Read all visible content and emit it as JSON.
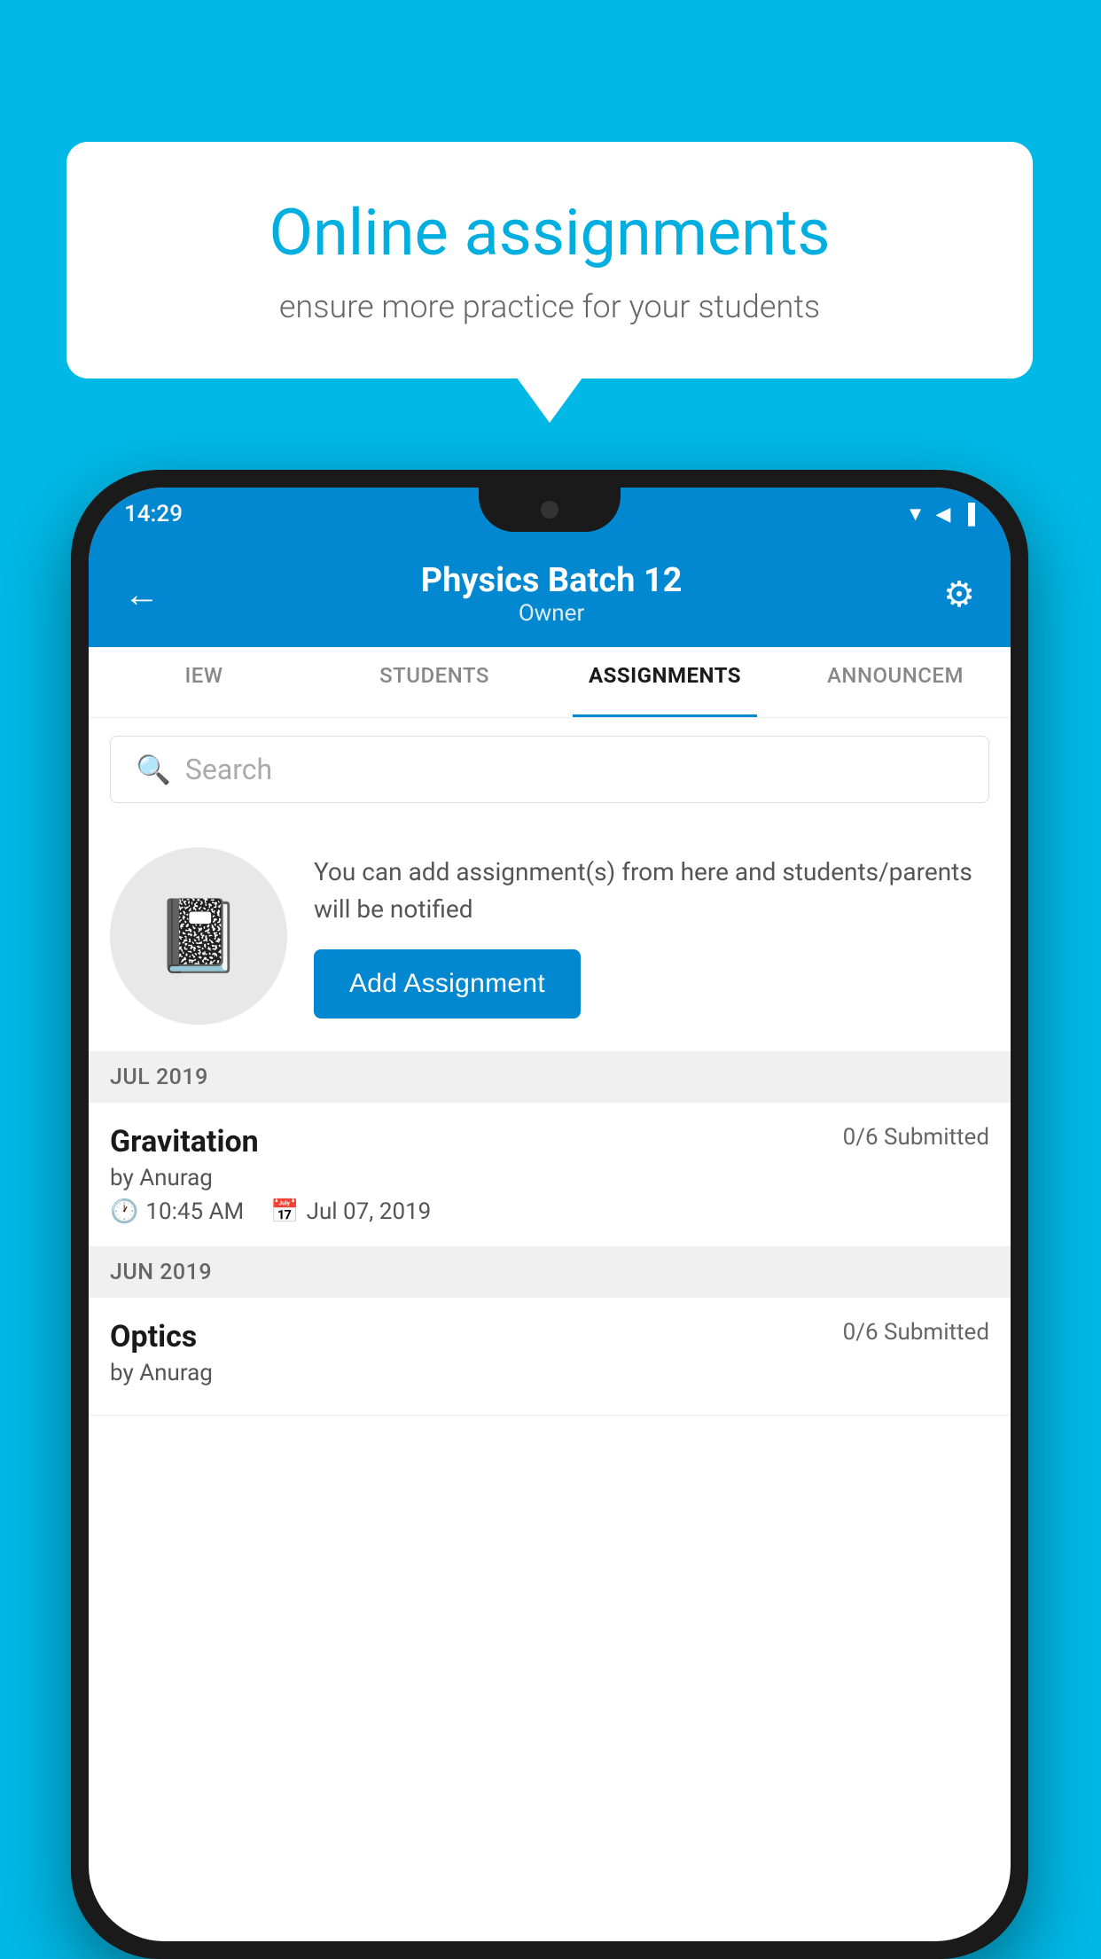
{
  "background": {
    "color": "#00b8e6"
  },
  "speech_bubble": {
    "title": "Online assignments",
    "subtitle": "ensure more practice for your students"
  },
  "status_bar": {
    "time": "14:29",
    "wifi_icon": "wifi",
    "signal_icon": "signal",
    "battery_icon": "battery"
  },
  "app_header": {
    "back_icon": "←",
    "title": "Physics Batch 12",
    "subtitle": "Owner",
    "settings_icon": "⚙"
  },
  "tabs": [
    {
      "label": "IEW",
      "active": false
    },
    {
      "label": "STUDENTS",
      "active": false
    },
    {
      "label": "ASSIGNMENTS",
      "active": true
    },
    {
      "label": "ANNOUNCEM",
      "active": false
    }
  ],
  "search": {
    "placeholder": "Search",
    "icon": "🔍"
  },
  "promo": {
    "icon": "📓",
    "text": "You can add assignment(s) from here and students/parents will be notified",
    "button_label": "Add Assignment"
  },
  "month_sections": [
    {
      "label": "JUL 2019",
      "assignments": [
        {
          "name": "Gravitation",
          "submitted": "0/6 Submitted",
          "author": "by Anurag",
          "time": "10:45 AM",
          "date": "Jul 07, 2019"
        }
      ]
    },
    {
      "label": "JUN 2019",
      "assignments": [
        {
          "name": "Optics",
          "submitted": "0/6 Submitted",
          "author": "by Anurag",
          "time": "",
          "date": ""
        }
      ]
    }
  ]
}
